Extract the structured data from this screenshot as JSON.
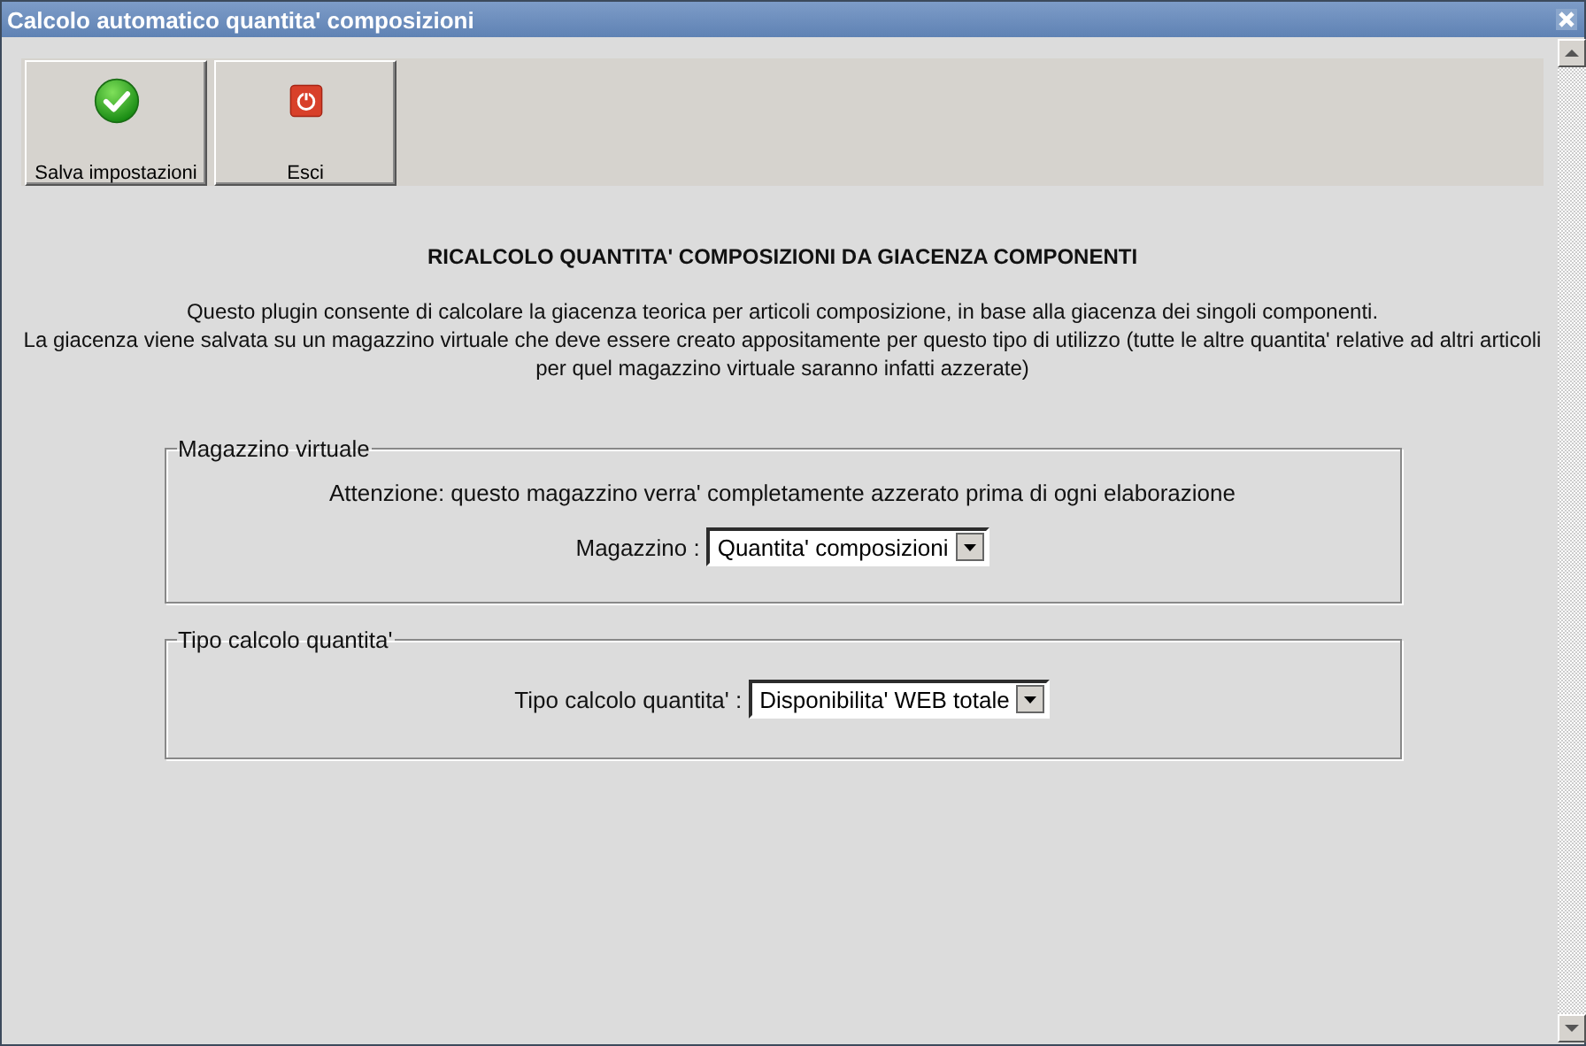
{
  "window": {
    "title": "Calcolo automatico quantita' composizioni"
  },
  "toolbar": [
    {
      "label": "Salva impostazioni",
      "kind": "save"
    },
    {
      "label": "Esci",
      "kind": "exit"
    }
  ],
  "heading": "RICALCOLO QUANTITA' COMPOSIZIONI DA GIACENZA COMPONENTI",
  "description": [
    "Questo plugin consente di calcolare la giacenza teorica per articoli composizione, in base alla giacenza dei singoli componenti.",
    "La giacenza viene salvata su un magazzino virtuale che deve essere creato appositamente per questo tipo di utilizzo (tutte le altre quantita' relative ad altri articoli per quel magazzino virtuale saranno infatti azzerate)"
  ],
  "groups": [
    {
      "title": "Magazzino virtuale",
      "note": "Attenzione: questo magazzino verra' completamente azzerato prima di ogni elaborazione",
      "field": {
        "label": "Magazzino :",
        "value": "Quantita' composizioni"
      }
    },
    {
      "title": "Tipo calcolo quantita'",
      "field": {
        "label": "Tipo calcolo quantita' :",
        "value": "Disponibilita' WEB totale"
      }
    }
  ]
}
